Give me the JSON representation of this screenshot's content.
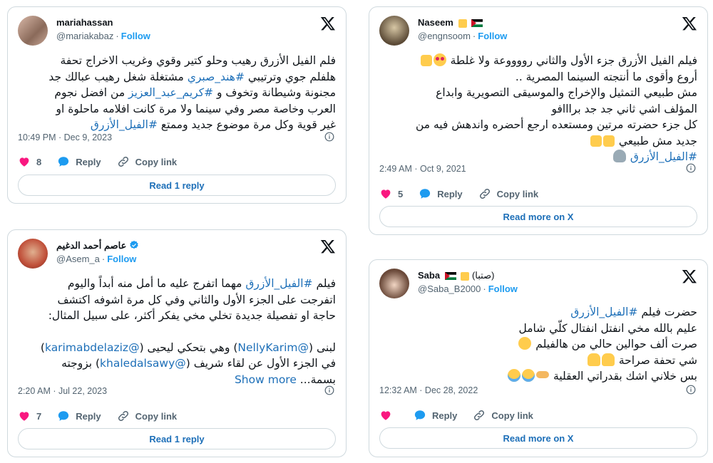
{
  "tweets": [
    {
      "name": "mariahassan",
      "handle": "@mariakabaz",
      "follow": "Follow",
      "lines": [
        "فلم الفيل الأزرق رهيب وحلو كتير وقوي وغريب الاخراج تحفة",
        "هلفلم جوي وترتيبي #هند_صبري مشتغلة شغل رهيب عبالك جد",
        "مجنونة وشيطانة وتخوف و #كريم_عبد_العزيز من افضل نجوم",
        "العرب وخاصة مصر وفي سينما ولا مرة كانت افلامه ماحلوة او",
        "غير قوية وكل مرة موضوع جديد وممتع #الفيل_الأزرق"
      ],
      "timestamp": "10:49 PM · Dec 9, 2023",
      "likes": "8",
      "reply": "Reply",
      "copy": "Copy link",
      "button": "Read 1 reply"
    },
    {
      "name": "Naseem",
      "handle": "@engnsoom",
      "follow": "Follow",
      "lines": [
        "فيلم الفيل الأزرق جزء الأول والثاني رووووعة ولا غلطة",
        "أروع وأقوى ما أنتجته السينما المصرية ..",
        "مش طبيعي التمثيل والإخراج والموسيقى التصويرية وابداع",
        "المؤلف اشي ثاني جد جد برااافو",
        "كل جزء حضرته مرتين ومستعده ارجع أحضره واندهش فيه من",
        "جديد مش طبيعي",
        "#الفيل_الأزرق"
      ],
      "timestamp": "2:49 AM · Oct 9, 2021",
      "likes": "5",
      "reply": "Reply",
      "copy": "Copy link",
      "button": "Read more on X"
    },
    {
      "name": "عاصم أحمد الدغيم",
      "handle": "@Asem_a",
      "follow": "Follow",
      "lines": [
        "فيلم #الفيل_الأزرق مهما اتفرج عليه ما أمل منه أبداً واليوم",
        "اتفرجت على الجزء الأول والثاني وفي كل مرة اشوفه اكتشف",
        "حاجة او تفصيلة جديدة تخلي مخي يفكر أكثر، على سبيل المثال:",
        "",
        "لبنى (@NellyKarim) وهي بتحكي ليحيى (@karimabdelaziz)",
        "في الجزء الأول عن لقاء شريف (@khaledalsawy) بزوجته",
        "بسمة... Show more"
      ],
      "show_more": "Show more",
      "timestamp": "2:20 AM · Jul 22, 2023",
      "likes": "7",
      "reply": "Reply",
      "copy": "Copy link",
      "button": "Read 1 reply"
    },
    {
      "name": "Saba",
      "name_suffix": "(صتبا)",
      "handle": "@Saba_B2000",
      "follow": "Follow",
      "lines": [
        "حضرت فيلم #الفيل_الأزرق",
        "عليم بالله مخي انفتل انفتال كلّي شامل",
        "صرت ألف حوالين حالي من هالفيلم",
        "شي تحفة صراحة",
        "بس خلاني اشك بقدراتي العقلية"
      ],
      "timestamp": "12:32 AM · Dec 28, 2022",
      "likes": "",
      "reply": "Reply",
      "copy": "Copy link",
      "button": "Read more on X"
    }
  ],
  "colors": {
    "link": "#1d6fb8",
    "like": "#f91880",
    "reply": "#1d9bf0",
    "border": "#cfd9de"
  }
}
